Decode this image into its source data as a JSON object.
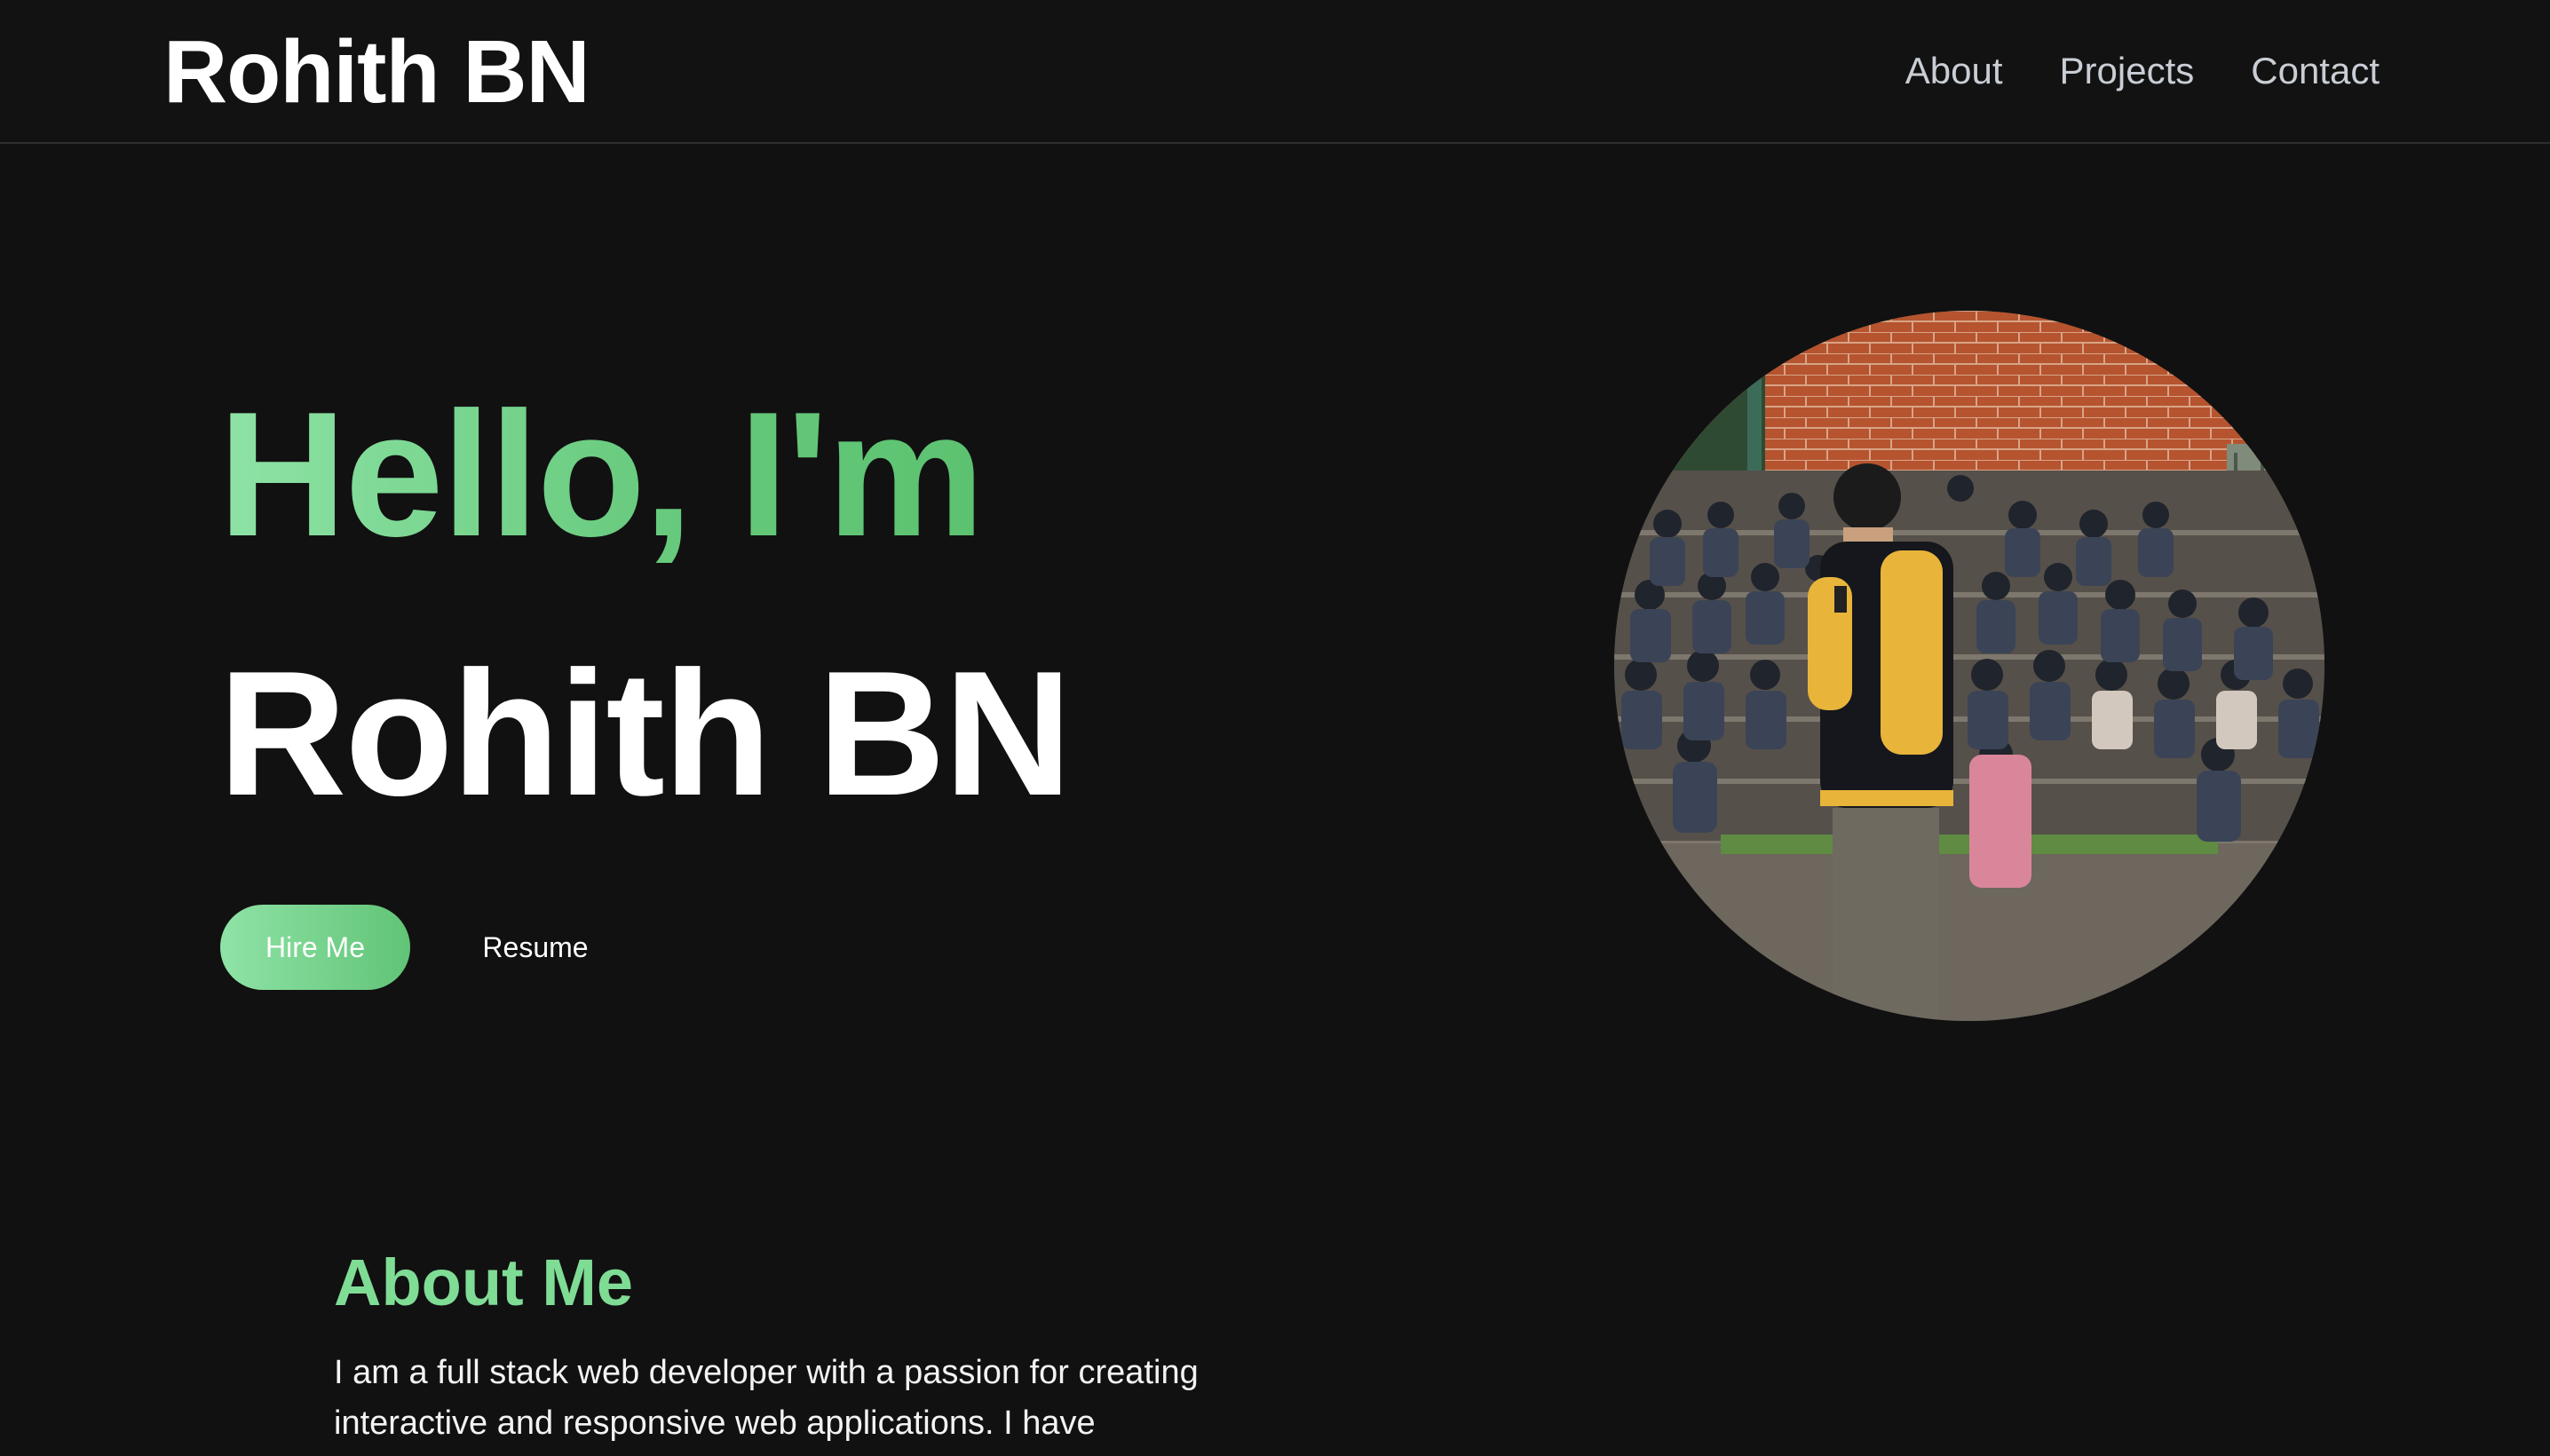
{
  "nav": {
    "brand": "Rohith BN",
    "links": [
      "About",
      "Projects",
      "Contact"
    ]
  },
  "hero": {
    "greeting": "Hello, I'm",
    "name": "Rohith BN",
    "hire_button": "Hire Me",
    "resume_button": "Resume"
  },
  "about": {
    "heading": "About Me",
    "text": "I am a full stack web developer with a passion for creating interactive and responsive web applications. I have"
  },
  "colors": {
    "background": "#111111",
    "accent": "#6fd186",
    "accent_light": "#8fe3a7"
  },
  "icons": {
    "portrait": "profile-photo"
  }
}
